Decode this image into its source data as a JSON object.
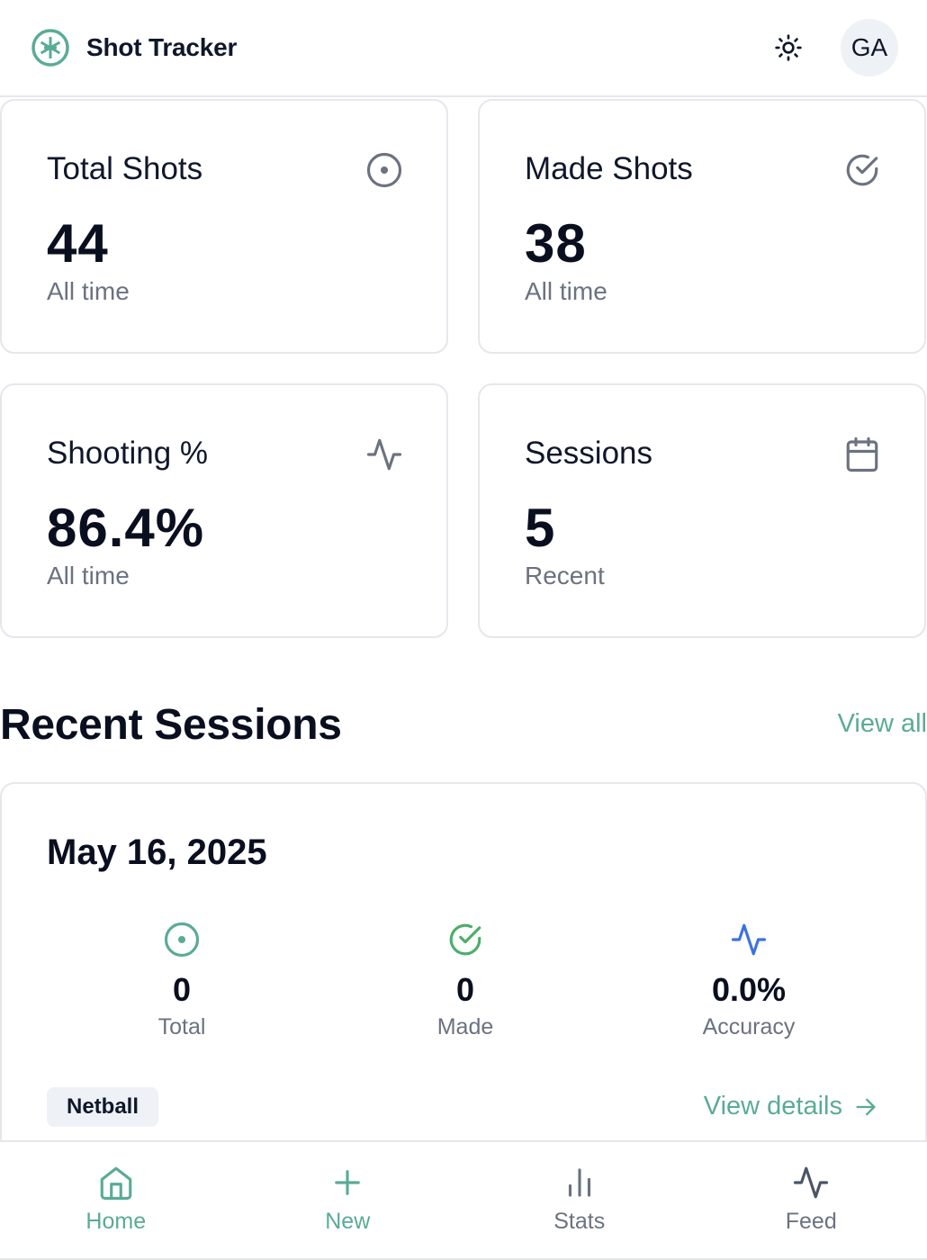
{
  "app": {
    "title": "Shot Tracker",
    "avatar_initials": "GA"
  },
  "colors": {
    "accent": "#5aab96",
    "success": "#4cae6a",
    "info": "#3b72e0",
    "muted": "#6b7280"
  },
  "stats": [
    {
      "label": "Total Shots",
      "value": "44",
      "sub": "All time",
      "icon": "target-icon"
    },
    {
      "label": "Made Shots",
      "value": "38",
      "sub": "All time",
      "icon": "check-circle-icon"
    },
    {
      "label": "Shooting %",
      "value": "86.4%",
      "sub": "All time",
      "icon": "activity-icon"
    },
    {
      "label": "Sessions",
      "value": "5",
      "sub": "Recent",
      "icon": "calendar-icon"
    }
  ],
  "recent": {
    "title": "Recent Sessions",
    "view_all": "View all",
    "session": {
      "date": "May 16, 2025",
      "metrics": [
        {
          "value": "0",
          "label": "Total"
        },
        {
          "value": "0",
          "label": "Made"
        },
        {
          "value": "0.0%",
          "label": "Accuracy"
        }
      ],
      "tag": "Netball",
      "details_label": "View details"
    }
  },
  "nav": [
    {
      "label": "Home",
      "icon": "home-icon",
      "active": true
    },
    {
      "label": "New",
      "icon": "plus-icon",
      "active": true
    },
    {
      "label": "Stats",
      "icon": "bar-chart-icon",
      "active": false
    },
    {
      "label": "Feed",
      "icon": "activity-icon",
      "active": false
    }
  ]
}
